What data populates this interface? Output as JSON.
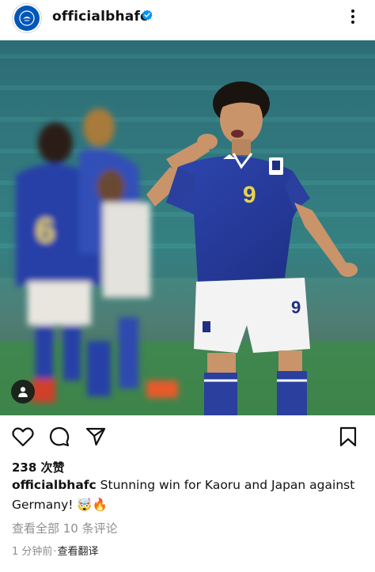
{
  "post": {
    "username": "officialbhafc",
    "verified": true,
    "more_icon": "more-vertical-icon",
    "avatar_icon": "brighton-club-crest"
  },
  "photo": {
    "description_icon": "photo",
    "tag_icon": "person-tag-icon"
  },
  "actions": {
    "like_icon": "heart-icon",
    "comment_icon": "comment-bubble-icon",
    "share_icon": "send-paper-plane-icon",
    "save_icon": "bookmark-icon"
  },
  "likes": {
    "count": "238",
    "label": "次赞"
  },
  "caption": {
    "username": "officialbhafc",
    "text": "Stunning win for Kaoru and Japan against Germany! 🤯🔥"
  },
  "comments": {
    "link_text": "查看全部 10 条评论"
  },
  "meta": {
    "time_ago": "1 分钟前",
    "separator": "·",
    "translate": "查看翻译"
  },
  "colors": {
    "verified_blue": "#0095f6",
    "muted_text": "#8e8e8e",
    "jersey_blue": "#2a3f9e",
    "pitch_green": "#3d8a4a"
  }
}
